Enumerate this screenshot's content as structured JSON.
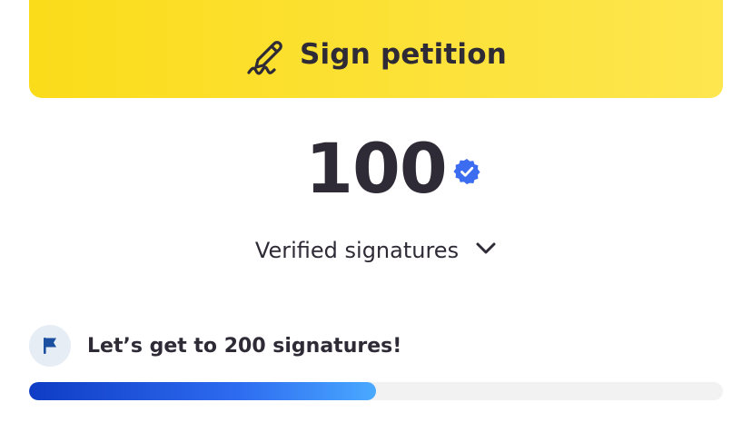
{
  "sign_button": {
    "label": "Sign petition",
    "icon": "pen-signature-icon",
    "color": "#fbdc1a"
  },
  "signatures": {
    "count": "100",
    "badge_icon": "verified-check-icon",
    "badge_color": "#3c6df0",
    "label": "Verified signatures",
    "dropdown_icon": "chevron-down-icon"
  },
  "goal": {
    "icon": "flag-icon",
    "text": "Let’s get to 200 signatures!",
    "progress_fraction": 0.5,
    "progress_colors": [
      "#0f3cc4",
      "#4aa9ff"
    ]
  }
}
